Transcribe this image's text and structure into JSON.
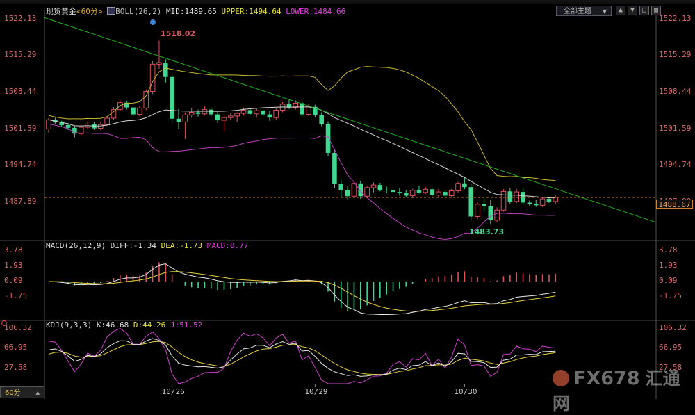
{
  "header": {
    "symbol": "现货黄金",
    "period_tag": "<60分>",
    "indicator": "BOLL(26,2)",
    "mid": "MID:1489.65",
    "upper": "UPPER:1494.64",
    "lower": "LOWER:1484.66",
    "theme_select": "全部主题"
  },
  "macd_header": {
    "label": "MACD(26,12,9)",
    "diff": "DIFF:-1.34",
    "dea": "DEA:-1.73",
    "macd": "MACD:0.77"
  },
  "kdj_header": {
    "label": "KDJ(9,3,3)",
    "k": "K:46.68",
    "d": "D:44.26",
    "j": "J:51.52"
  },
  "price_axis": [
    "1522.13",
    "1515.29",
    "1508.44",
    "1501.59",
    "1494.74",
    "1487.89"
  ],
  "macd_axis": [
    "3.78",
    "1.93",
    "0.09",
    "-1.75"
  ],
  "kdj_axis": [
    "106.32",
    "66.95",
    "27.58"
  ],
  "current_price": "1488.67",
  "annotations": {
    "high": "1518.02",
    "low": "1483.73"
  },
  "x_labels": [
    "10/26",
    "10/29",
    "10/30"
  ],
  "period_button": "60分",
  "watermark": {
    "brand": "FX678",
    "cn": "汇通网"
  },
  "colors": {
    "up": "#e0505a",
    "down": "#40d890",
    "mid_band": "#d8d8d8",
    "upper_band": "#c8b830",
    "lower_band": "#c040c0",
    "trendline": "#20b020",
    "diff": "#e8e8e8",
    "dea": "#e8d040",
    "k": "#e8e8e8",
    "d": "#e8d040",
    "j": "#d040d0"
  },
  "chart_data": {
    "type": "candlestick",
    "title": "现货黄金",
    "price_range": [
      1481,
      1523
    ],
    "candles": [
      [
        1501.5,
        1503.5,
        1500.8,
        1503.2
      ],
      [
        1503.2,
        1503.6,
        1502.4,
        1502.7
      ],
      [
        1502.7,
        1503.0,
        1501.8,
        1502.2
      ],
      [
        1502.2,
        1502.6,
        1501.3,
        1501.7
      ],
      [
        1501.7,
        1502.0,
        1499.9,
        1500.6
      ],
      [
        1500.6,
        1502.2,
        1500.3,
        1501.8
      ],
      [
        1501.8,
        1502.9,
        1501.4,
        1502.4
      ],
      [
        1502.4,
        1502.8,
        1501.3,
        1501.6
      ],
      [
        1501.6,
        1502.7,
        1501.3,
        1502.3
      ],
      [
        1502.3,
        1503.8,
        1502.1,
        1503.5
      ],
      [
        1503.5,
        1505.6,
        1503.2,
        1505.1
      ],
      [
        1505.1,
        1506.9,
        1504.8,
        1506.4
      ],
      [
        1506.4,
        1506.8,
        1505.1,
        1505.5
      ],
      [
        1505.5,
        1506.2,
        1503.8,
        1504.2
      ],
      [
        1504.2,
        1505.7,
        1503.9,
        1505.4
      ],
      [
        1505.4,
        1508.9,
        1505.0,
        1508.5
      ],
      [
        1508.5,
        1514.2,
        1508.0,
        1513.6
      ],
      [
        1513.6,
        1518.0,
        1512.7,
        1513.9
      ],
      [
        1513.9,
        1514.5,
        1510.1,
        1511.2
      ],
      [
        1511.2,
        1511.6,
        1502.5,
        1503.4
      ],
      [
        1503.4,
        1505.2,
        1501.5,
        1502.8
      ],
      [
        1502.8,
        1504.6,
        1499.6,
        1504.1
      ],
      [
        1504.1,
        1505.4,
        1503.6,
        1504.6
      ],
      [
        1504.6,
        1505.1,
        1503.8,
        1504.3
      ],
      [
        1504.3,
        1505.7,
        1504.0,
        1505.1
      ],
      [
        1505.1,
        1505.5,
        1503.9,
        1504.2
      ],
      [
        1504.2,
        1504.8,
        1502.6,
        1503.1
      ],
      [
        1503.1,
        1504.0,
        1501.0,
        1503.6
      ],
      [
        1503.6,
        1504.5,
        1503.1,
        1503.9
      ],
      [
        1503.9,
        1504.6,
        1502.8,
        1504.4
      ],
      [
        1504.4,
        1505.5,
        1504.0,
        1505.0
      ],
      [
        1505.0,
        1505.4,
        1504.0,
        1504.3
      ],
      [
        1504.3,
        1505.3,
        1503.6,
        1504.9
      ],
      [
        1504.9,
        1505.2,
        1503.9,
        1504.2
      ],
      [
        1504.2,
        1504.8,
        1503.0,
        1503.6
      ],
      [
        1503.6,
        1505.4,
        1503.2,
        1505.0
      ],
      [
        1505.0,
        1506.5,
        1504.6,
        1506.1
      ],
      [
        1506.1,
        1507.1,
        1505.2,
        1505.5
      ],
      [
        1505.5,
        1506.8,
        1505.1,
        1506.3
      ],
      [
        1506.3,
        1506.6,
        1503.8,
        1504.2
      ],
      [
        1504.2,
        1506.2,
        1503.9,
        1505.6
      ],
      [
        1505.6,
        1506.0,
        1503.7,
        1504.1
      ],
      [
        1504.1,
        1504.6,
        1502.0,
        1502.4
      ],
      [
        1502.4,
        1502.9,
        1496.4,
        1497.0
      ],
      [
        1497.0,
        1497.6,
        1490.4,
        1491.2
      ],
      [
        1491.2,
        1492.0,
        1488.6,
        1490.1
      ],
      [
        1490.1,
        1490.8,
        1488.3,
        1488.9
      ],
      [
        1488.9,
        1491.6,
        1488.5,
        1491.3
      ],
      [
        1491.3,
        1491.8,
        1488.4,
        1488.9
      ],
      [
        1488.9,
        1490.9,
        1488.6,
        1490.5
      ],
      [
        1490.5,
        1491.5,
        1489.6,
        1491.0
      ],
      [
        1491.0,
        1491.4,
        1489.8,
        1490.1
      ],
      [
        1490.1,
        1490.7,
        1489.4,
        1490.0
      ],
      [
        1490.0,
        1490.5,
        1489.3,
        1489.7
      ],
      [
        1489.7,
        1490.4,
        1489.0,
        1489.5
      ],
      [
        1489.5,
        1490.0,
        1488.7,
        1489.0
      ],
      [
        1489.0,
        1490.3,
        1488.8,
        1490.0
      ],
      [
        1490.0,
        1490.9,
        1489.4,
        1489.6
      ],
      [
        1489.6,
        1490.6,
        1489.3,
        1490.2
      ],
      [
        1490.2,
        1490.6,
        1488.8,
        1489.1
      ],
      [
        1489.1,
        1490.3,
        1488.6,
        1489.7
      ],
      [
        1489.7,
        1490.1,
        1488.7,
        1489.0
      ],
      [
        1489.0,
        1490.3,
        1488.6,
        1489.9
      ],
      [
        1489.9,
        1491.6,
        1489.6,
        1491.3
      ],
      [
        1491.3,
        1492.4,
        1490.2,
        1490.6
      ],
      [
        1490.6,
        1491.2,
        1484.3,
        1485.1
      ],
      [
        1485.1,
        1487.7,
        1484.6,
        1487.4
      ],
      [
        1487.4,
        1488.6,
        1486.2,
        1487.0
      ],
      [
        1487.0,
        1488.2,
        1483.7,
        1484.4
      ],
      [
        1484.4,
        1486.8,
        1484.0,
        1486.3
      ],
      [
        1486.3,
        1490.2,
        1486.0,
        1489.8
      ],
      [
        1489.8,
        1490.4,
        1487.4,
        1487.9
      ],
      [
        1487.9,
        1490.3,
        1487.6,
        1489.7
      ],
      [
        1489.7,
        1490.4,
        1487.3,
        1487.7
      ],
      [
        1487.7,
        1488.1,
        1487.1,
        1487.5
      ],
      [
        1487.5,
        1488.2,
        1486.9,
        1487.2
      ],
      [
        1487.2,
        1488.7,
        1486.9,
        1488.4
      ],
      [
        1488.4,
        1488.7,
        1487.6,
        1487.9
      ],
      [
        1487.9,
        1489.0,
        1487.5,
        1488.7
      ]
    ],
    "macd": {
      "range": [
        -4.5,
        4.5
      ]
    },
    "kdj": {
      "range": [
        -5,
        112
      ]
    },
    "x_ticks": [
      {
        "label": "10/26",
        "index": 19
      },
      {
        "label": "10/29",
        "index": 41
      },
      {
        "label": "10/30",
        "index": 64
      }
    ]
  }
}
